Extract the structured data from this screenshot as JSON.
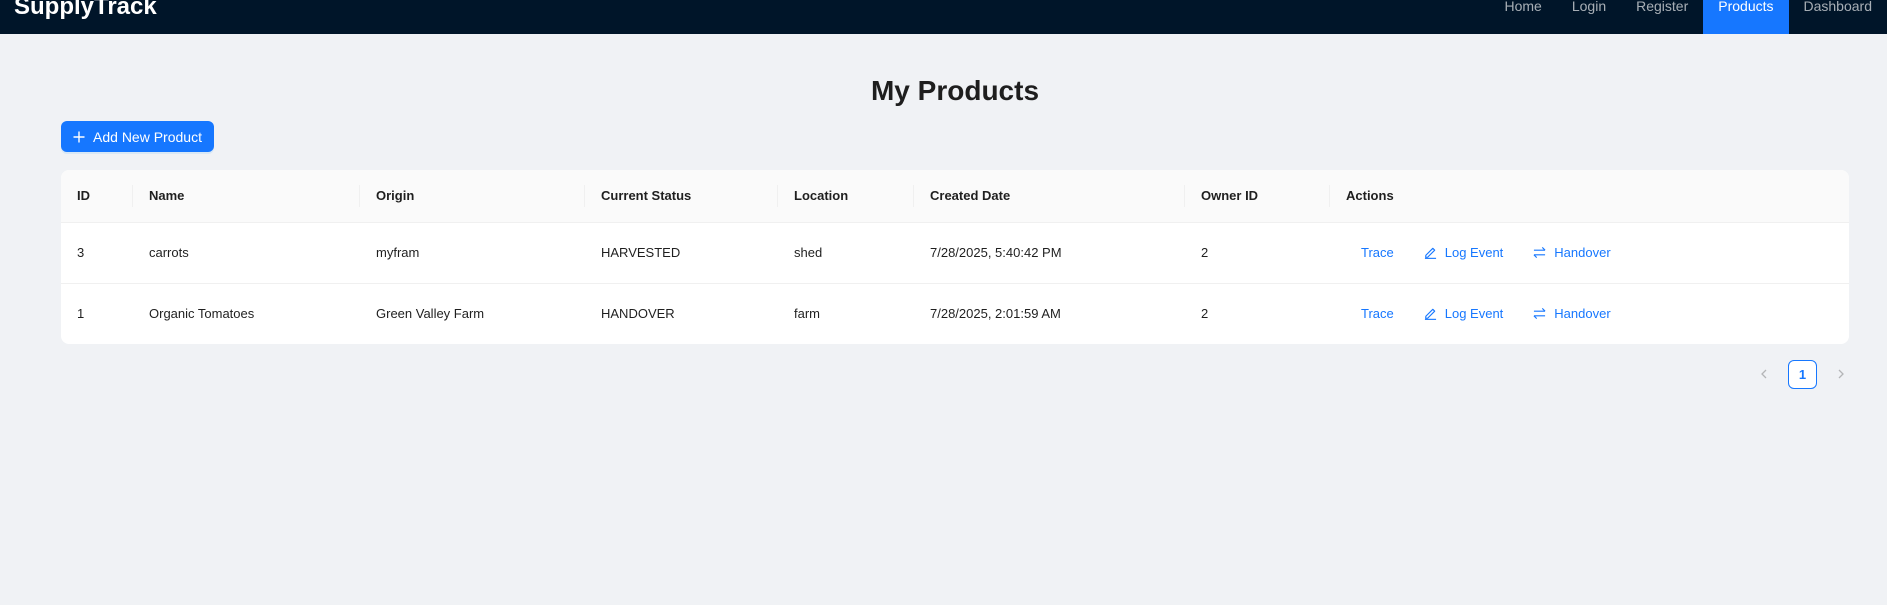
{
  "app": {
    "name": "SupplyTrack"
  },
  "nav": {
    "items": [
      {
        "label": "Home"
      },
      {
        "label": "Login"
      },
      {
        "label": "Register"
      },
      {
        "label": "Products"
      },
      {
        "label": "Dashboard"
      }
    ],
    "active_index": 3
  },
  "page": {
    "title": "My Products",
    "add_button_label": "Add New Product"
  },
  "table": {
    "columns": [
      "ID",
      "Name",
      "Origin",
      "Current Status",
      "Location",
      "Created Date",
      "Owner ID",
      "Actions"
    ],
    "rows": [
      {
        "id": "3",
        "name": "carrots",
        "origin": "myfram",
        "status": "HARVESTED",
        "location": "shed",
        "created": "7/28/2025, 5:40:42 PM",
        "owner_id": "2"
      },
      {
        "id": "1",
        "name": "Organic Tomatoes",
        "origin": "Green Valley Farm",
        "status": "HANDOVER",
        "location": "farm",
        "created": "7/28/2025, 2:01:59 AM",
        "owner_id": "2"
      }
    ],
    "actions": {
      "trace": "Trace",
      "log_event": "Log Event",
      "handover": "Handover"
    }
  },
  "pagination": {
    "current_page": "1"
  },
  "colors": {
    "navbar": "#001529",
    "primary": "#1677ff",
    "background": "#f0f2f5"
  }
}
